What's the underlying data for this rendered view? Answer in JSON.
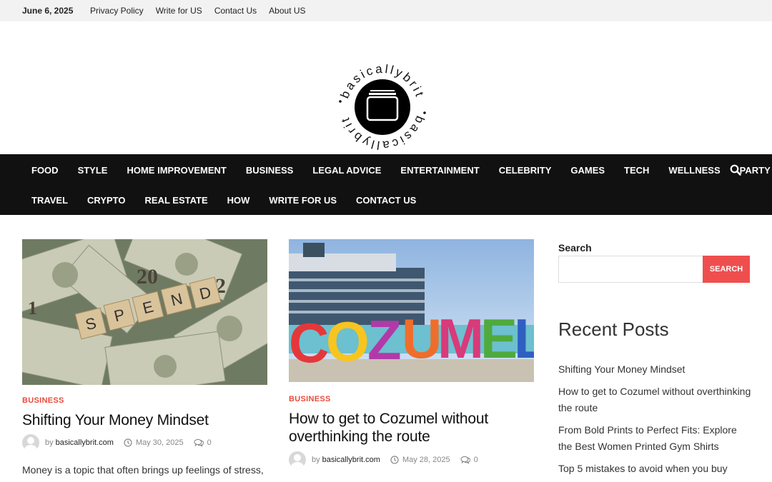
{
  "topbar": {
    "date": "June 6, 2025",
    "links": [
      "Privacy Policy",
      "Write for US",
      "Contact Us",
      "About US"
    ]
  },
  "logo": {
    "text": "basicallybrit"
  },
  "nav": {
    "row1": [
      "FOOD",
      "STYLE",
      "HOME IMPROVEMENT",
      "BUSINESS",
      "LEGAL ADVICE",
      "ENTERTAINMENT",
      "CELEBRITY",
      "GAMES",
      "TECH",
      "WELLNESS",
      "PARTY"
    ],
    "row2": [
      "TRAVEL",
      "CRYPTO",
      "REAL ESTATE",
      "HOW",
      "WRITE FOR US",
      "CONTACT US"
    ],
    "search_icon": "search-icon"
  },
  "posts": [
    {
      "category": "BUSINESS",
      "title_lines": [
        "Shifting Your Money Mindset"
      ],
      "by": "by",
      "author": "basicallybrit.com",
      "date": "May 30, 2025",
      "comments": "0",
      "excerpt": "Money is a topic that often brings up feelings of stress,",
      "tiles": [
        "S",
        "P",
        "E",
        "N",
        "D"
      ]
    },
    {
      "category": "BUSINESS",
      "title_lines": [
        "How to get to Cozumel without",
        "overthinking the route"
      ],
      "by": "by",
      "author": "basicallybrit.com",
      "date": "May 28, 2025",
      "comments": "0",
      "letters": [
        "C",
        "O",
        "Z",
        "U",
        "M",
        "E",
        "L"
      ]
    }
  ],
  "sidebar": {
    "search_label": "Search",
    "search_placeholder": "",
    "search_button": "SEARCH",
    "recent_title": "Recent Posts",
    "recent_posts": [
      "Shifting Your Money Mindset",
      "How to get to Cozumel without overthinking the route",
      "From Bold Prints to Perfect Fits: Explore the Best Women Printed Gym Shirts",
      "Top 5 mistakes to avoid when you buy"
    ]
  },
  "colors": {
    "accent": "#ef4e4e",
    "nav_bg": "#111111",
    "topbar_bg": "#f2f2f2"
  }
}
